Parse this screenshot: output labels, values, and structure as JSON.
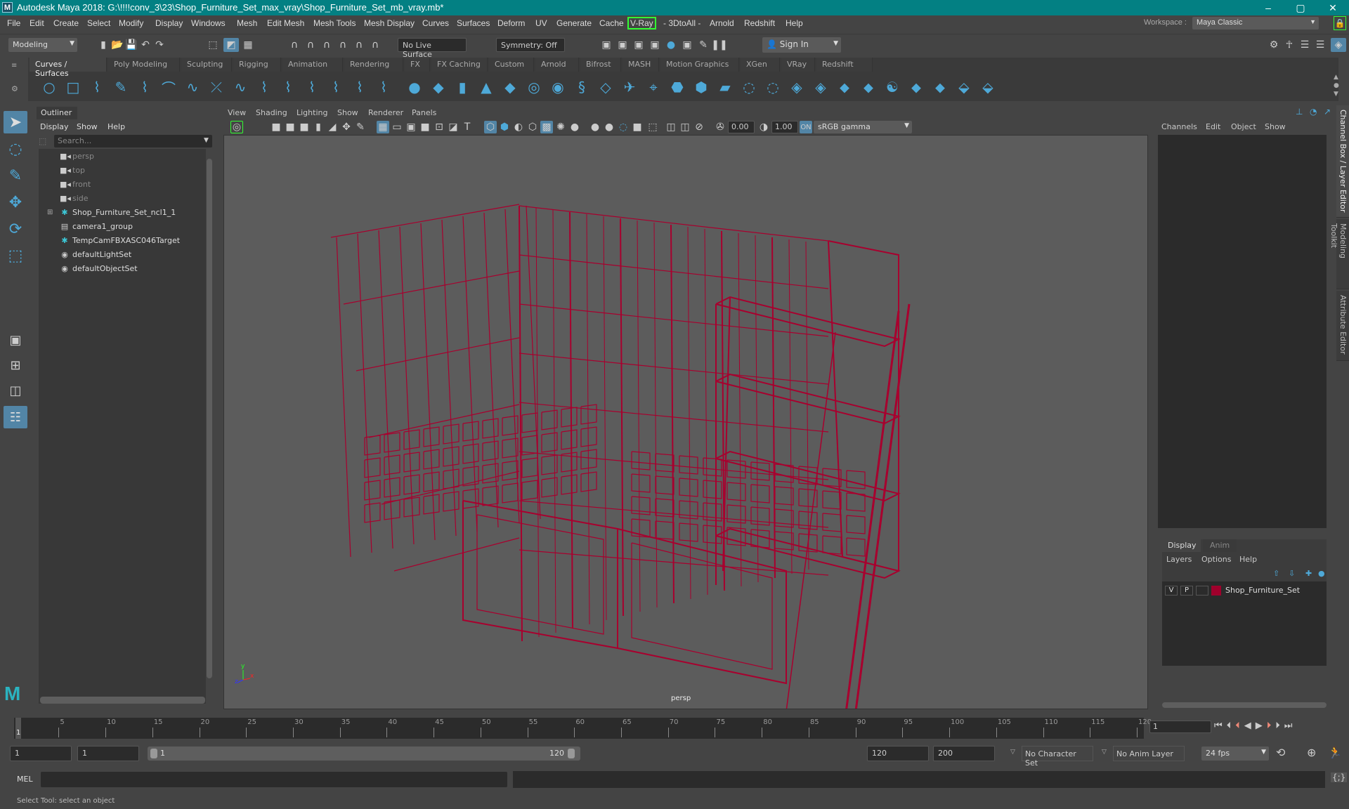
{
  "titlebar": {
    "title": "Autodesk Maya 2018: G:\\!!!!conv_3\\23\\Shop_Furniture_Set_max_vray\\Shop_Furniture_Set_mb_vray.mb*",
    "minimize": "–",
    "maximize": "▢",
    "close": "✕"
  },
  "menubar": {
    "items": [
      "File",
      "Edit",
      "Create",
      "Select",
      "Modify",
      "Display",
      "Windows",
      "Mesh",
      "Edit Mesh",
      "Mesh Tools",
      "Mesh Display",
      "Curves",
      "Surfaces",
      "Deform",
      "UV",
      "Generate",
      "Cache",
      "V-Ray",
      "- 3DtoAll -",
      "Arnold",
      "Redshift",
      "Help"
    ],
    "workspace_label": "Workspace :",
    "workspace_value": "Maya Classic"
  },
  "statusline": {
    "mode": "Modeling",
    "live_surface": "No Live Surface",
    "symmetry": "Symmetry: Off",
    "sign_in": "Sign In"
  },
  "shelf": {
    "tabs": [
      "Curves / Surfaces",
      "Poly Modeling",
      "Sculpting",
      "Rigging",
      "Animation",
      "Rendering",
      "FX",
      "FX Caching",
      "Custom",
      "Arnold",
      "Bifrost",
      "MASH",
      "Motion Graphics",
      "XGen",
      "VRay",
      "Redshift"
    ],
    "active_tab": "Curves / Surfaces"
  },
  "outliner": {
    "tab": "Outliner",
    "menu": [
      "Display",
      "Show",
      "Help"
    ],
    "search_placeholder": "Search...",
    "items": [
      {
        "label": "persp",
        "icon": "camera-icon",
        "dim": true
      },
      {
        "label": "top",
        "icon": "camera-icon",
        "dim": true
      },
      {
        "label": "front",
        "icon": "camera-icon",
        "dim": true
      },
      {
        "label": "side",
        "icon": "camera-icon",
        "dim": true
      },
      {
        "label": "Shop_Furniture_Set_ncl1_1",
        "icon": "transform-icon",
        "expandable": true
      },
      {
        "label": "camera1_group",
        "icon": "group-icon"
      },
      {
        "label": "TempCamFBXASC046Target",
        "icon": "transform-icon"
      },
      {
        "label": "defaultLightSet",
        "icon": "set-icon"
      },
      {
        "label": "defaultObjectSet",
        "icon": "set-icon"
      }
    ]
  },
  "viewport": {
    "menu": [
      "View",
      "Shading",
      "Lighting",
      "Show",
      "Renderer",
      "Panels"
    ],
    "exposure": "0.00",
    "gamma": "1.00",
    "color_space": "sRGB gamma",
    "camera_label": "persp",
    "wire_color": "#a8002e",
    "axis": {
      "x": "x",
      "y": "y",
      "z": "z"
    }
  },
  "channelbox": {
    "menu": [
      "Channels",
      "Edit",
      "Object",
      "Show"
    ],
    "vertical_tabs": [
      "Channel Box / Layer Editor",
      "Modeling Toolkit",
      "Attribute Editor"
    ]
  },
  "layereditor": {
    "tabs": [
      "Display",
      "Anim"
    ],
    "menu": [
      "Layers",
      "Options",
      "Help"
    ],
    "layer": {
      "v": "V",
      "p": "P",
      "name": "Shop_Furniture_Set",
      "color": "#a0002c"
    }
  },
  "timeline": {
    "ticks": [
      "5",
      "10",
      "15",
      "20",
      "25",
      "30",
      "35",
      "40",
      "45",
      "50",
      "55",
      "60",
      "65",
      "70",
      "75",
      "80",
      "85",
      "90",
      "95",
      "100",
      "105",
      "110",
      "115",
      "120"
    ],
    "current_marker": "1",
    "current_frame": "1"
  },
  "range": {
    "start": "1",
    "playback_start": "1",
    "slider_start": "1",
    "slider_end": "120",
    "playback_end": "120",
    "end": "200",
    "character_set": "No Character Set",
    "anim_layer": "No Anim Layer",
    "fps": "24 fps"
  },
  "cmdline": {
    "label": "MEL"
  },
  "helpline": {
    "text": "Select Tool: select an object"
  }
}
